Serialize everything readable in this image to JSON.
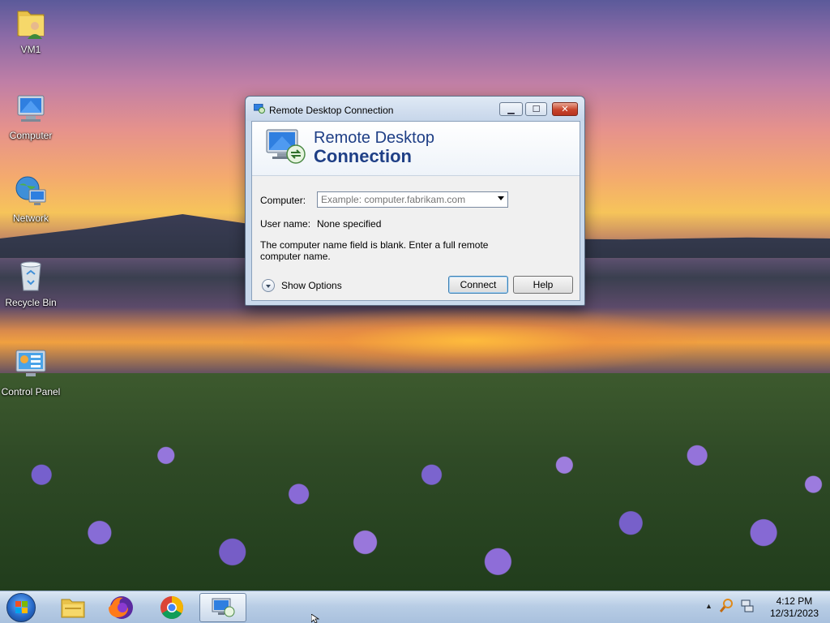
{
  "desktop": {
    "icons": [
      {
        "label": "VM1",
        "icon": "user-folder-icon"
      },
      {
        "label": "Computer",
        "icon": "computer-icon"
      },
      {
        "label": "Network",
        "icon": "network-icon"
      },
      {
        "label": "Recycle Bin",
        "icon": "recycle-bin-icon"
      },
      {
        "label": "Control Panel",
        "icon": "control-panel-icon"
      }
    ]
  },
  "dialog": {
    "title": "Remote Desktop Connection",
    "banner_line1": "Remote Desktop",
    "banner_line2": "Connection",
    "computer_label": "Computer:",
    "computer_placeholder": "Example: computer.fabrikam.com",
    "computer_value": "",
    "username_label": "User name:",
    "username_value": "None specified",
    "message": "The computer name field is blank. Enter a full remote computer name.",
    "show_options_label": "Show Options",
    "connect_label": "Connect",
    "help_label": "Help",
    "window_buttons": {
      "minimize": "minimize-icon",
      "maximize": "maximize-icon",
      "close": "close-icon"
    }
  },
  "taskbar": {
    "items": [
      {
        "icon": "file-explorer-icon"
      },
      {
        "icon": "firefox-icon"
      },
      {
        "icon": "chrome-icon"
      },
      {
        "icon": "remote-desktop-icon",
        "active": true
      }
    ],
    "clock_time": "4:12 PM",
    "clock_date": "12/31/2023"
  }
}
